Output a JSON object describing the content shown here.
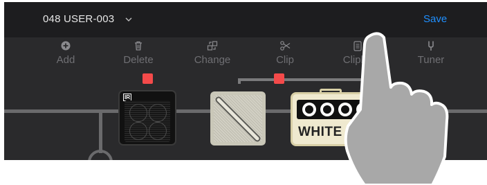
{
  "topbar": {
    "preset_name": "048 USER-003",
    "save_label": "Save"
  },
  "toolbar": {
    "add": "Add",
    "delete": "Delete",
    "change": "Change",
    "clip": "Clip",
    "clipboard": "Clipbo",
    "tuner": "Tuner"
  },
  "chain": {
    "ir_badge": "IR",
    "amp_name": "WHITE CAB"
  },
  "icons": [
    "chevron-down-icon",
    "plus-circle-icon",
    "trash-icon",
    "swap-icon",
    "scissors-icon",
    "clipboard-icon",
    "tuning-fork-icon"
  ],
  "colors": {
    "accent": "#1f8fff",
    "marker": "#f44a4a",
    "background": "#2a2a2c",
    "topbar": "#1d1d1f"
  }
}
